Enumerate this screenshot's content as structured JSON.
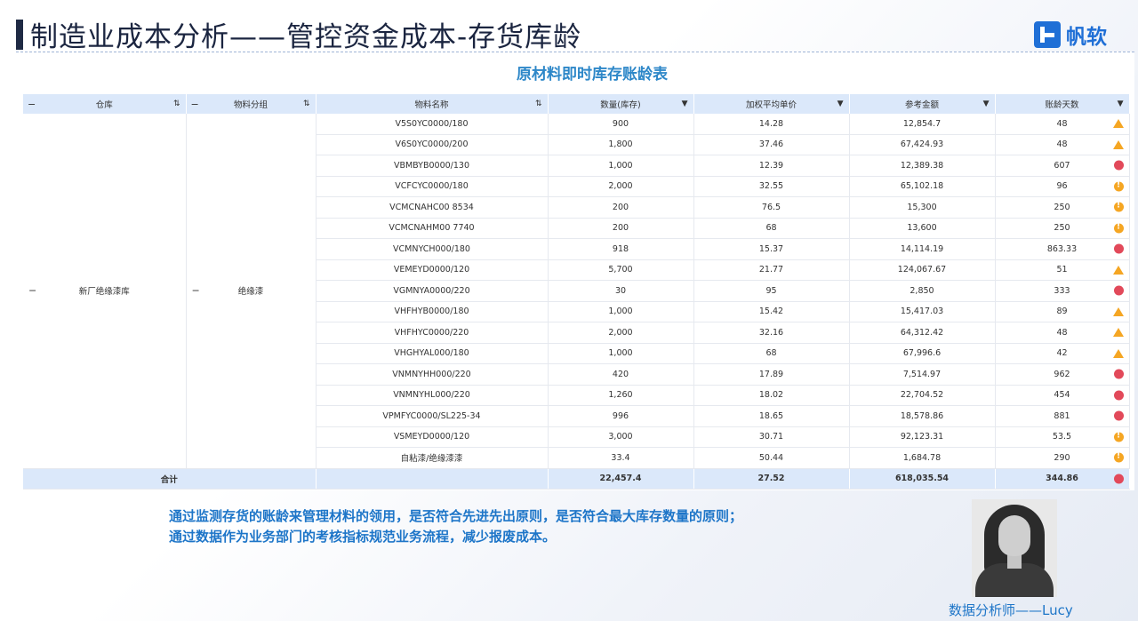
{
  "header": {
    "title": "制造业成本分析——管控资金成本-存货库龄",
    "logo_text": "帆软"
  },
  "table": {
    "title": "原材料即时库存账龄表",
    "columns": [
      {
        "label": "仓库",
        "icon": "sort-icon"
      },
      {
        "label": "物料分组",
        "icon": "sort-icon"
      },
      {
        "label": "物料名称",
        "icon": "sort-icon"
      },
      {
        "label": "数量(库存)",
        "icon": "dropdown-icon"
      },
      {
        "label": "加权平均单价",
        "icon": "dropdown-icon"
      },
      {
        "label": "参考金额",
        "icon": "dropdown-icon"
      },
      {
        "label": "账龄天数",
        "icon": "dropdown-icon"
      }
    ],
    "warehouse": "新厂绝缘漆库",
    "group": "绝缘漆",
    "rows": [
      {
        "name": "V5S0YC0000/180",
        "qty": "900",
        "price": "14.28",
        "amount": "12,854.7",
        "days": "48",
        "status": "triangle"
      },
      {
        "name": "V6S0YC0000/200",
        "qty": "1,800",
        "price": "37.46",
        "amount": "67,424.93",
        "days": "48",
        "status": "triangle"
      },
      {
        "name": "VBMBYB0000/130",
        "qty": "1,000",
        "price": "12.39",
        "amount": "12,389.38",
        "days": "607",
        "status": "red"
      },
      {
        "name": "VCFCYC0000/180",
        "qty": "2,000",
        "price": "32.55",
        "amount": "65,102.18",
        "days": "96",
        "status": "orange"
      },
      {
        "name": "VCMCNAHC00 8534",
        "qty": "200",
        "price": "76.5",
        "amount": "15,300",
        "days": "250",
        "status": "orange"
      },
      {
        "name": "VCMCNAHM00 7740",
        "qty": "200",
        "price": "68",
        "amount": "13,600",
        "days": "250",
        "status": "orange"
      },
      {
        "name": "VCMNYCH000/180",
        "qty": "918",
        "price": "15.37",
        "amount": "14,114.19",
        "days": "863.33",
        "status": "red"
      },
      {
        "name": "VEMEYD0000/120",
        "qty": "5,700",
        "price": "21.77",
        "amount": "124,067.67",
        "days": "51",
        "status": "triangle"
      },
      {
        "name": "VGMNYA0000/220",
        "qty": "30",
        "price": "95",
        "amount": "2,850",
        "days": "333",
        "status": "red"
      },
      {
        "name": "VHFHYB0000/180",
        "qty": "1,000",
        "price": "15.42",
        "amount": "15,417.03",
        "days": "89",
        "status": "triangle"
      },
      {
        "name": "VHFHYC0000/220",
        "qty": "2,000",
        "price": "32.16",
        "amount": "64,312.42",
        "days": "48",
        "status": "triangle"
      },
      {
        "name": "VHGHYAL000/180",
        "qty": "1,000",
        "price": "68",
        "amount": "67,996.6",
        "days": "42",
        "status": "triangle"
      },
      {
        "name": "VNMNYHH000/220",
        "qty": "420",
        "price": "17.89",
        "amount": "7,514.97",
        "days": "962",
        "status": "red"
      },
      {
        "name": "VNMNYHL000/220",
        "qty": "1,260",
        "price": "18.02",
        "amount": "22,704.52",
        "days": "454",
        "status": "red"
      },
      {
        "name": "VPMFYC0000/SL225-34",
        "qty": "996",
        "price": "18.65",
        "amount": "18,578.86",
        "days": "881",
        "status": "red"
      },
      {
        "name": "VSMEYD0000/120",
        "qty": "3,000",
        "price": "30.71",
        "amount": "92,123.31",
        "days": "53.5",
        "status": "orange"
      },
      {
        "name": "自粘漆/绝缘漆漆",
        "qty": "33.4",
        "price": "50.44",
        "amount": "1,684.78",
        "days": "290",
        "status": "orange"
      }
    ],
    "total": {
      "label": "合计",
      "qty": "22,457.4",
      "price": "27.52",
      "amount": "618,035.54",
      "days": "344.86",
      "status": "red"
    }
  },
  "description": {
    "line1": "通过监测存货的账龄来管理材料的领用，是否符合先进先出原则，是否符合最大库存数量的原则；",
    "line2": "通过数据作为业务部门的考核指标规范业务流程，减少报废成本。"
  },
  "analyst": {
    "caption": "数据分析师——Lucy"
  },
  "colors": {
    "accent": "#1d75c8",
    "header_bg": "#dbe8fa",
    "status_red": "#e2495a",
    "status_orange": "#f5a623"
  }
}
